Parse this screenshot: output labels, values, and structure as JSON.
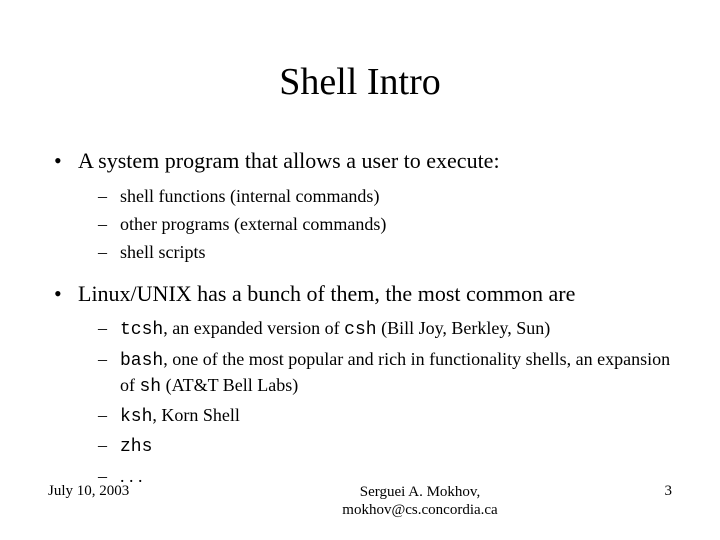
{
  "title": "Shell Intro",
  "bullets": [
    {
      "text": "A system program that allows a user to execute:",
      "sub": [
        {
          "plain": "shell functions (internal commands)"
        },
        {
          "plain": "other programs (external commands)"
        },
        {
          "plain": "shell scripts"
        }
      ]
    },
    {
      "text": "Linux/UNIX has a bunch of them, the most common are",
      "sub": [
        {
          "mono1": "tcsh",
          "rest1": ", an expanded version of ",
          "mono2": "csh",
          "rest2": " (Bill Joy, Berkley, Sun)"
        },
        {
          "mono1": "bash",
          "rest1": ", one of the most popular and rich in functionality shells, an expansion of ",
          "mono2": "sh",
          "rest2": " (AT&T Bell Labs)"
        },
        {
          "mono1": "ksh",
          "rest1": ", Korn Shell"
        },
        {
          "mono1": "zhs"
        },
        {
          "plain": ". . ."
        }
      ]
    }
  ],
  "footer": {
    "date": "July 10, 2003",
    "author_line1": "Serguei A. Mokhov,",
    "author_line2": "mokhov@cs.concordia.ca",
    "page": "3"
  }
}
